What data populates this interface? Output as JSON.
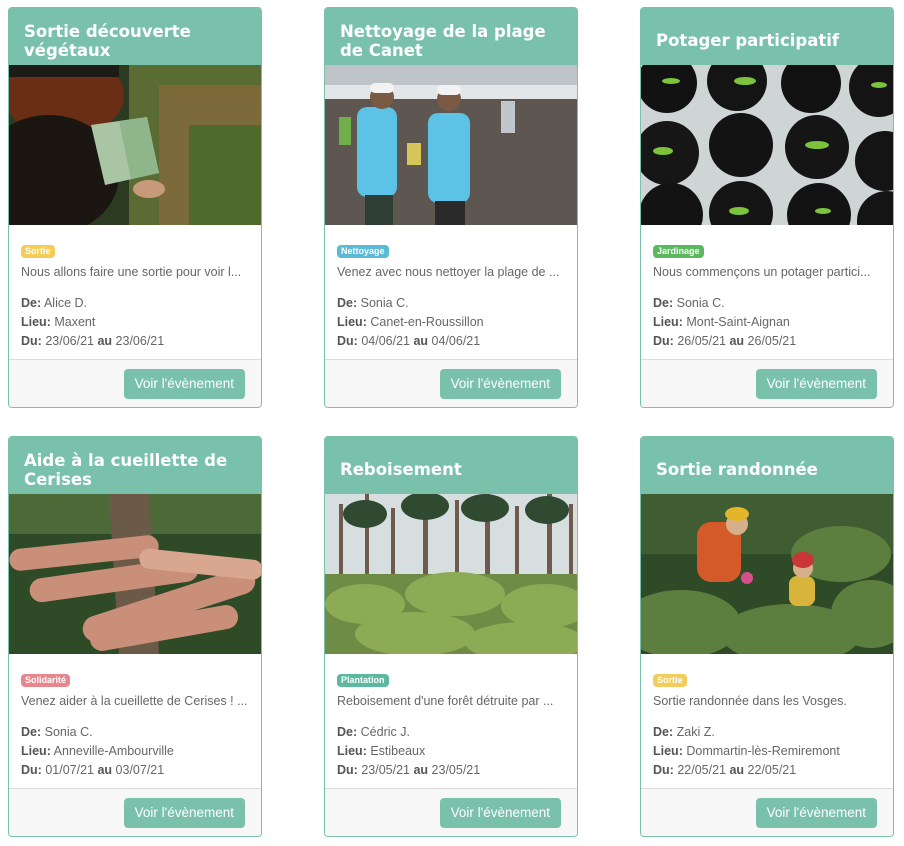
{
  "events": [
    {
      "title": "Sortie découverte végétaux",
      "tag": "Sortie",
      "tag_color": "#f3cc5a",
      "tag_icon": "reading-person-forest-photo",
      "desc": "Nous allons faire une sortie pour voir l...",
      "de_label": "De:",
      "de": "Alice D.",
      "lieu_label": "Lieu:",
      "lieu": "Maxent",
      "du_label": "Du:",
      "du": "23/06/21",
      "au_label": "au",
      "au": "23/06/21",
      "button": "Voir l'évènement"
    },
    {
      "title": "Nettoyage de la plage de Canet",
      "tag": "Nettoyage",
      "tag_color": "#5bbad5",
      "tag_icon": "beach-cleanup-photo",
      "desc": "Venez avec nous nettoyer la plage de ...",
      "de_label": "De:",
      "de": "Sonia C.",
      "lieu_label": "Lieu:",
      "lieu": "Canet-en-Roussillon",
      "du_label": "Du:",
      "du": "04/06/21",
      "au_label": "au",
      "au": "04/06/21",
      "button": "Voir l'évènement"
    },
    {
      "title": "Potager participatif",
      "tag": "Jardinage",
      "tag_color": "#5cb85c",
      "tag_icon": "seedling-pots-photo",
      "desc": "Nous commençons un potager partici...",
      "de_label": "De:",
      "de": "Sonia C.",
      "lieu_label": "Lieu:",
      "lieu": "Mont-Saint-Aignan",
      "du_label": "Du:",
      "du": "26/05/21",
      "au_label": "au",
      "au": "26/05/21",
      "button": "Voir l'évènement"
    },
    {
      "title": "Aide à la cueillette de Cerises",
      "tag": "Solidarité",
      "tag_color": "#e8868f",
      "tag_icon": "hands-on-log-photo",
      "desc": "Venez aider à la cueillette de Cerises !  ...",
      "de_label": "De:",
      "de": "Sonia C.",
      "lieu_label": "Lieu:",
      "lieu": "Anneville-Ambourville",
      "du_label": "Du:",
      "du": "01/07/21",
      "au_label": "au",
      "au": "03/07/21",
      "button": "Voir l'évènement"
    },
    {
      "title": "Reboisement",
      "tag": "Plantation",
      "tag_color": "#5cb89e",
      "tag_icon": "pine-forest-photo",
      "desc": "Reboisement d'une forêt détruite par ...",
      "de_label": "De:",
      "de": "Cédric J.",
      "lieu_label": "Lieu:",
      "lieu": "Estibeaux",
      "du_label": "Du:",
      "du": "23/05/21",
      "au_label": "au",
      "au": "23/05/21",
      "button": "Voir l'évènement"
    },
    {
      "title": "Sortie randonnée",
      "tag": "Sortie",
      "tag_color": "#f3cc5a",
      "tag_icon": "hikers-garden-photo",
      "desc": "Sortie randonnée dans les Vosges.",
      "de_label": "De:",
      "de": "Zaki Z.",
      "lieu_label": "Lieu:",
      "lieu": "Dommartin-lès-Remiremont",
      "du_label": "Du:",
      "du": "22/05/21",
      "au_label": "au",
      "au": "22/05/21",
      "button": "Voir l'évènement"
    }
  ]
}
